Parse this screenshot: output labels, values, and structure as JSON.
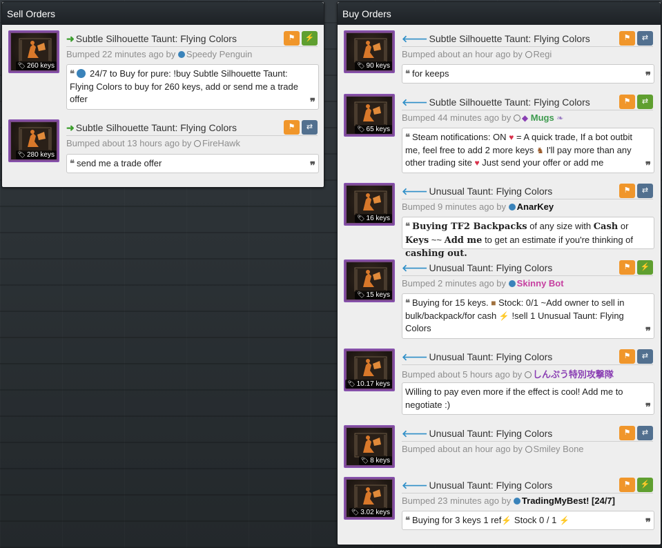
{
  "sell_panel": {
    "title": "Sell Orders",
    "listings": [
      {
        "item": "Subtle Silhouette Taunt: Flying Colors",
        "price": "260 keys",
        "bumped": "Bumped 22 minutes ago by",
        "user": "Speedy Penguin",
        "message_pre": "24/7 to Buy for pure: !buy Subtle Silhouette Taunt: Flying Colors to buy for 260 keys, add or send me a trade offer"
      },
      {
        "item": "Subtle Silhouette Taunt: Flying Colors",
        "price": "280 keys",
        "bumped": "Bumped about 13 hours ago by",
        "user": "FireHawk",
        "message": "send me a trade offer"
      }
    ]
  },
  "buy_panel": {
    "title": "Buy Orders",
    "listings": [
      {
        "item": "Subtle Silhouette Taunt: Flying Colors",
        "price": "90 keys",
        "bumped": "Bumped about an hour ago by",
        "user": "Regi",
        "message": "for keeps"
      },
      {
        "item": "Subtle Silhouette Taunt: Flying Colors",
        "price": "65 keys",
        "bumped": "Bumped 44 minutes ago by",
        "user": "Mugs",
        "msg_a": "Steam notifications: ON",
        "msg_b": "= A quick trade, If a bot outbit me, feel free to add 2 more keys",
        "msg_c": "I'll pay more than any other trading site",
        "msg_d": "Just send your offer or add me"
      },
      {
        "item": "Unusual Taunt: Flying Colors",
        "price": "16 keys",
        "bumped": "Bumped 9 minutes ago by",
        "user": "AnarKey",
        "msg_a": "Buying TF2 Backpacks",
        "msg_b": "of any size with",
        "msg_c": "Cash",
        "msg_d": "or",
        "msg_e": "Keys",
        "msg_f": "~~",
        "msg_g": "Add me",
        "msg_h": "to get an estimate if you're thinking of",
        "msg_i": "cashing out."
      },
      {
        "item": "Unusual Taunt: Flying Colors",
        "price": "15 keys",
        "bumped": "Bumped 2 minutes ago by",
        "user": "Skinny Bot",
        "msg_a": "Buying for 15 keys.",
        "msg_b": "Stock: 0/1 ~Add owner to sell in bulk/backpack/for cash",
        "msg_c": "!sell 1 Unusual Taunt: Flying Colors"
      },
      {
        "item": "Unusual Taunt: Flying Colors",
        "price": "10.17 keys",
        "bumped": "Bumped about 5 hours ago by",
        "user": "しんぷう特別攻撃隊",
        "message": "Willing to pay even more if the effect is cool! Add me to negotiate :)"
      },
      {
        "item": "Unusual Taunt: Flying Colors",
        "price": "8 keys",
        "bumped": "Bumped about an hour ago by",
        "user": "Smiley Bone"
      },
      {
        "item": "Unusual Taunt: Flying Colors",
        "price": "3.02 keys",
        "bumped": "Bumped 23 minutes ago by",
        "user": "TradingMyBest! [24/7]",
        "msg_a": "Buying for 3 keys 1 ref",
        "msg_b": "Stock 0 / 1"
      }
    ]
  },
  "colors": {
    "flag": "#f0962b",
    "bolt": "#5f9f30",
    "swap": "#52708f",
    "sell_arrow": "#3c9e2d",
    "buy_arrow": "#2f8fc8",
    "unusual_border": "#8650ac"
  },
  "icons": {
    "sell_direction": "arrow-right-icon",
    "buy_direction": "arrow-left-icon",
    "report": "flag-icon",
    "instant": "lightning-icon",
    "trade_offer": "swap-icon",
    "price_tag": "tag-icon",
    "quote": "quote-icon"
  }
}
